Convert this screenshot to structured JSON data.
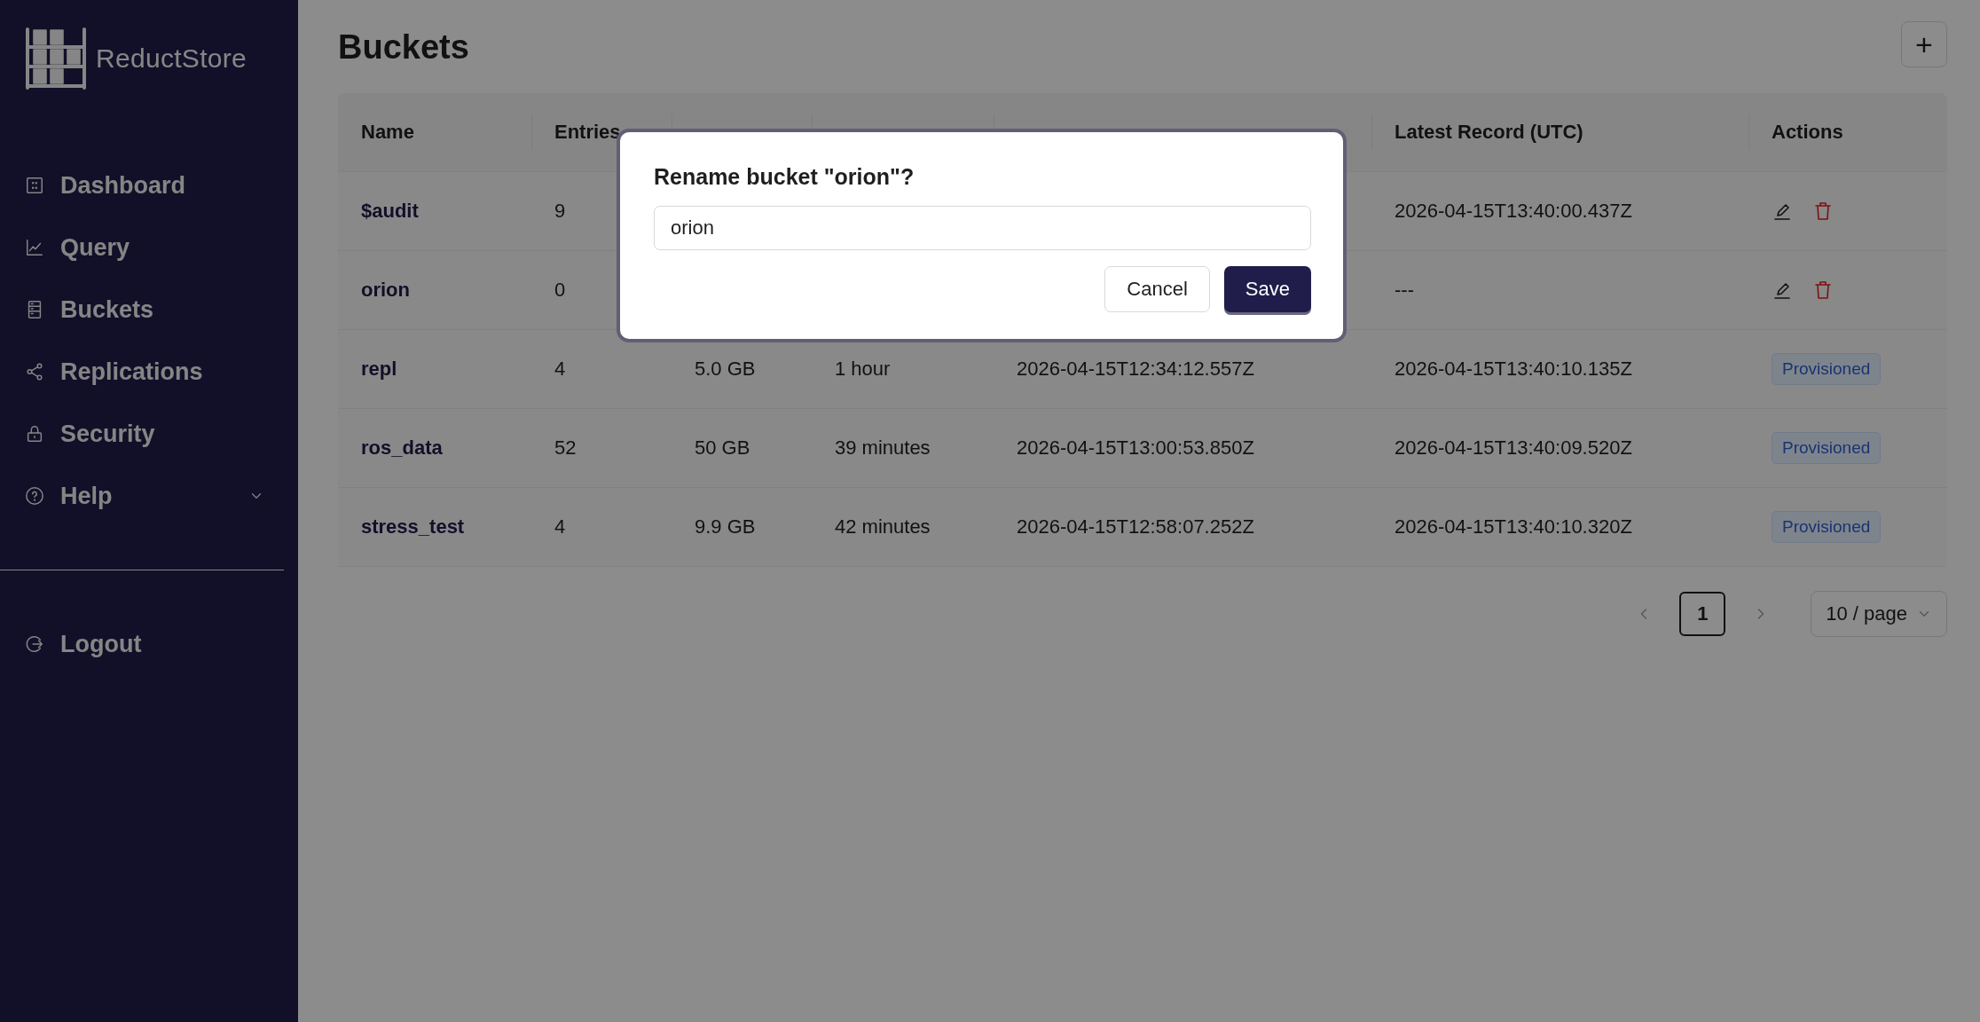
{
  "sidebar": {
    "logo_text": "ReductStore",
    "items": [
      {
        "label": "Dashboard",
        "kind": "link"
      },
      {
        "label": "Query",
        "kind": "link"
      },
      {
        "label": "Buckets",
        "kind": "link"
      },
      {
        "label": "Replications",
        "kind": "link"
      },
      {
        "label": "Security",
        "kind": "link"
      },
      {
        "label": "Help",
        "kind": "group"
      }
    ],
    "logout": {
      "label": "Logout"
    }
  },
  "page": {
    "title": "Buckets",
    "add_button": "+"
  },
  "table": {
    "header": {
      "name": "Name",
      "entries": "Entries",
      "latest_record": "Latest Record (UTC)",
      "actions": "Actions"
    },
    "rows": [
      {
        "name": "$audit",
        "entries": "9",
        "latest_record": "2026-04-15T13:40:00.437Z",
        "actions": {
          "kind": "edit_delete"
        }
      },
      {
        "name": "orion",
        "entries": "0",
        "latest_record": "---",
        "actions": {
          "kind": "edit_delete"
        }
      },
      {
        "name": "repl",
        "entries": "4",
        "size": "5.0 GB",
        "history": "1 hour",
        "oldest_record": "2026-04-15T12:34:12.557Z",
        "latest_record": "2026-04-15T13:40:10.135Z",
        "actions": {
          "kind": "badge",
          "label": "Provisioned"
        }
      },
      {
        "name": "ros_data",
        "entries": "52",
        "size": "50 GB",
        "history": "39 minutes",
        "oldest_record": "2026-04-15T13:00:53.850Z",
        "latest_record": "2026-04-15T13:40:09.520Z",
        "actions": {
          "kind": "badge",
          "label": "Provisioned"
        }
      },
      {
        "name": "stress_test",
        "entries": "4",
        "size": "9.9 GB",
        "history": "42 minutes",
        "oldest_record": "2026-04-15T12:58:07.252Z",
        "latest_record": "2026-04-15T13:40:10.320Z",
        "actions": {
          "kind": "badge",
          "label": "Provisioned"
        }
      }
    ]
  },
  "pagination": {
    "pages": [
      {
        "label": "1",
        "selected": true
      }
    ],
    "page_size": "10 / page"
  },
  "modal": {
    "title": "Rename bucket \"orion\"?",
    "input_value": "orion",
    "buttons": [
      {
        "label": "Cancel",
        "kind": "secondary"
      },
      {
        "label": "Save",
        "kind": "primary"
      }
    ]
  }
}
